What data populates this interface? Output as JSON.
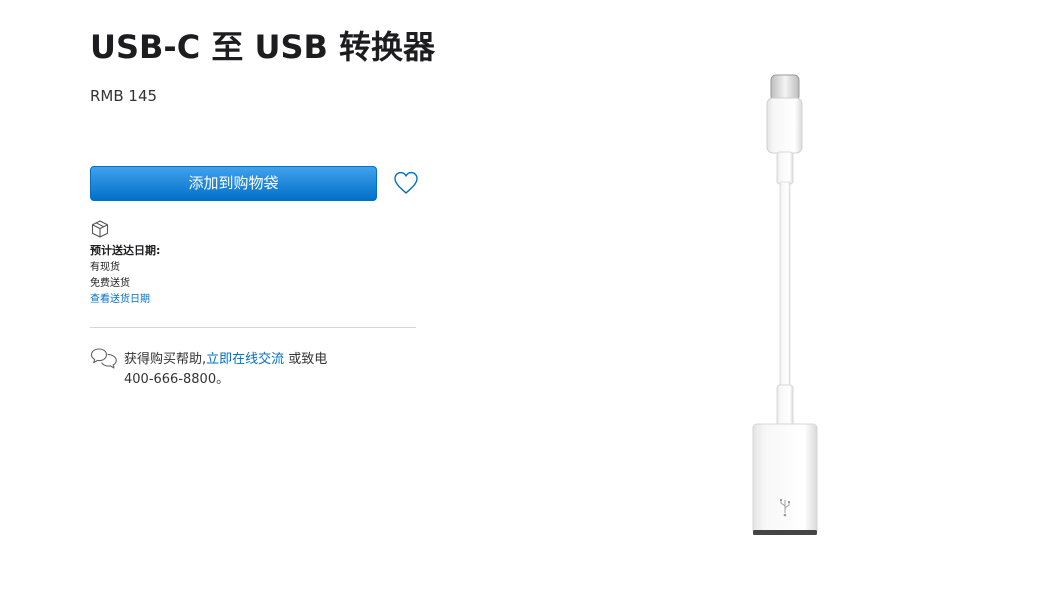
{
  "product": {
    "title": "USB-C 至 USB 转换器",
    "price": "RMB 145"
  },
  "actions": {
    "add_to_bag": "添加到购物袋",
    "favorite_icon": "heart-icon"
  },
  "delivery": {
    "icon": "box-icon",
    "heading": "预计送达日期:",
    "stock": "有现货",
    "shipping": "免费送货",
    "link": "查看送货日期"
  },
  "help": {
    "icon": "chat-bubbles-icon",
    "prefix": "获得购买帮助,",
    "chat_link": "立即在线交流",
    "suffix": "或致电",
    "phone": "400-666-8800。"
  },
  "colors": {
    "button_top": "#42a1ec",
    "button_bottom": "#0070c9",
    "link": "#0070c9",
    "text": "#1d1d1f"
  }
}
